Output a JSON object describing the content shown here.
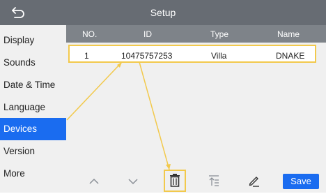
{
  "titlebar": {
    "title": "Setup"
  },
  "sidebar": {
    "items": [
      {
        "label": "Display"
      },
      {
        "label": "Sounds"
      },
      {
        "label": "Date & Time"
      },
      {
        "label": "Language"
      },
      {
        "label": "Devices"
      },
      {
        "label": "Version"
      },
      {
        "label": "More"
      }
    ],
    "active": "Devices"
  },
  "table": {
    "columns": [
      "NO.",
      "ID",
      "Type",
      "Name"
    ],
    "rows": [
      {
        "no": "1",
        "id": "10475757253",
        "type": "Villa",
        "name": "DNAKE"
      }
    ]
  },
  "toolbar": {
    "icons": [
      "up-arrow-icon",
      "down-arrow-icon",
      "trash-icon",
      "move-to-top-icon",
      "edit-icon"
    ],
    "save_label": "Save"
  },
  "colors": {
    "accent": "#1a6cf0",
    "highlight": "#f2c94c",
    "titlebar": "#676c73",
    "header": "#7e8389"
  }
}
